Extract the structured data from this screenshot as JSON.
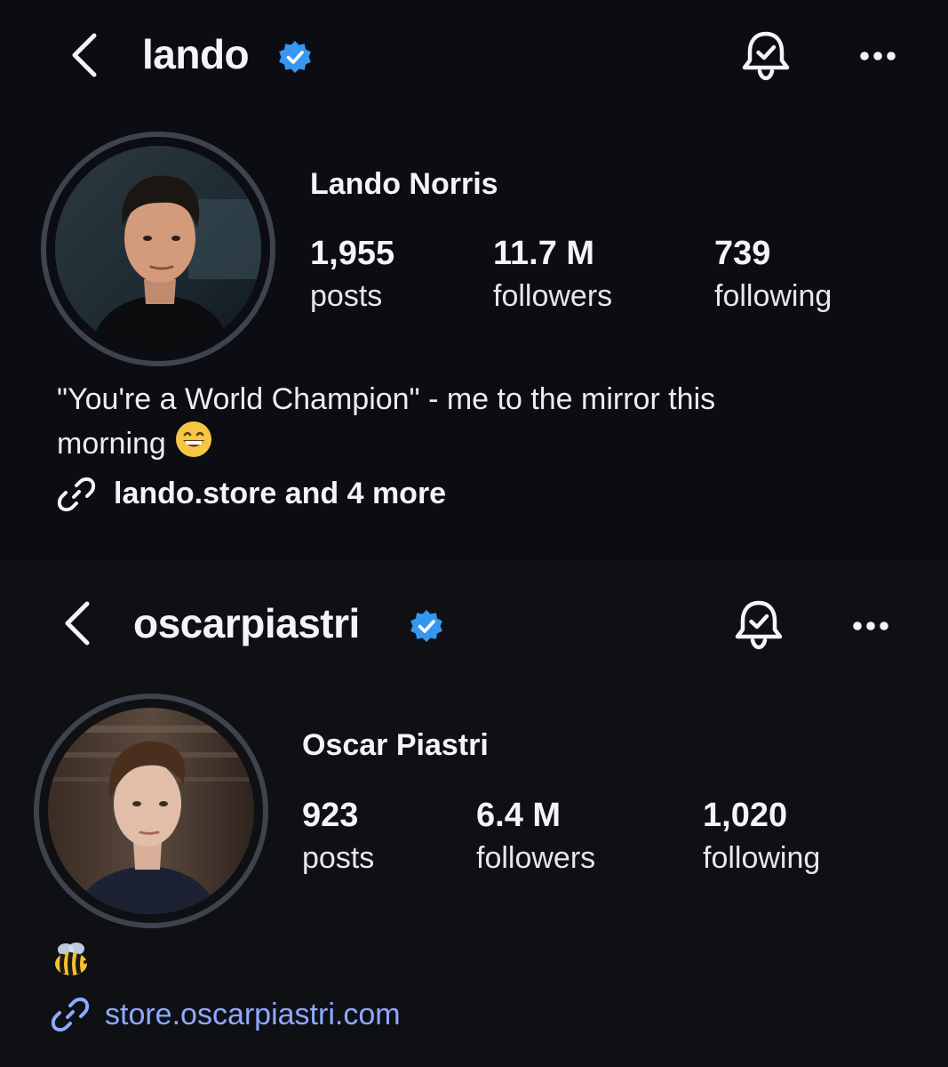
{
  "colors": {
    "background": "#0d0f13",
    "verified_badge": "#3797f0",
    "link_blue": "#8fa9ff",
    "avatar_ring": "#3e434d"
  },
  "profiles": [
    {
      "username": "lando",
      "verified": true,
      "full_name": "Lando Norris",
      "stats": {
        "posts": {
          "value": "1,955",
          "label": "posts"
        },
        "followers": {
          "value": "11.7 M",
          "label": "followers"
        },
        "following": {
          "value": "739",
          "label": "following"
        }
      },
      "bio_line1": "\"You're a World Champion\" - me to the mirror this",
      "bio_line2": "morning",
      "bio_emoji": "grinning-face-emoji",
      "link_text": "lando.store and 4 more",
      "icons": [
        "chevron-left-icon",
        "verified-badge-icon",
        "bell-icon",
        "more-icon",
        "link-icon"
      ]
    },
    {
      "username": "oscarpiastri",
      "verified": true,
      "full_name": "Oscar Piastri",
      "stats": {
        "posts": {
          "value": "923",
          "label": "posts"
        },
        "followers": {
          "value": "6.4 M",
          "label": "followers"
        },
        "following": {
          "value": "1,020",
          "label": "following"
        }
      },
      "bio_emoji": "bee-emoji",
      "link_text": "store.oscarpiastri.com",
      "icons": [
        "chevron-left-icon",
        "verified-badge-icon",
        "bell-icon",
        "more-icon",
        "link-icon"
      ]
    }
  ]
}
